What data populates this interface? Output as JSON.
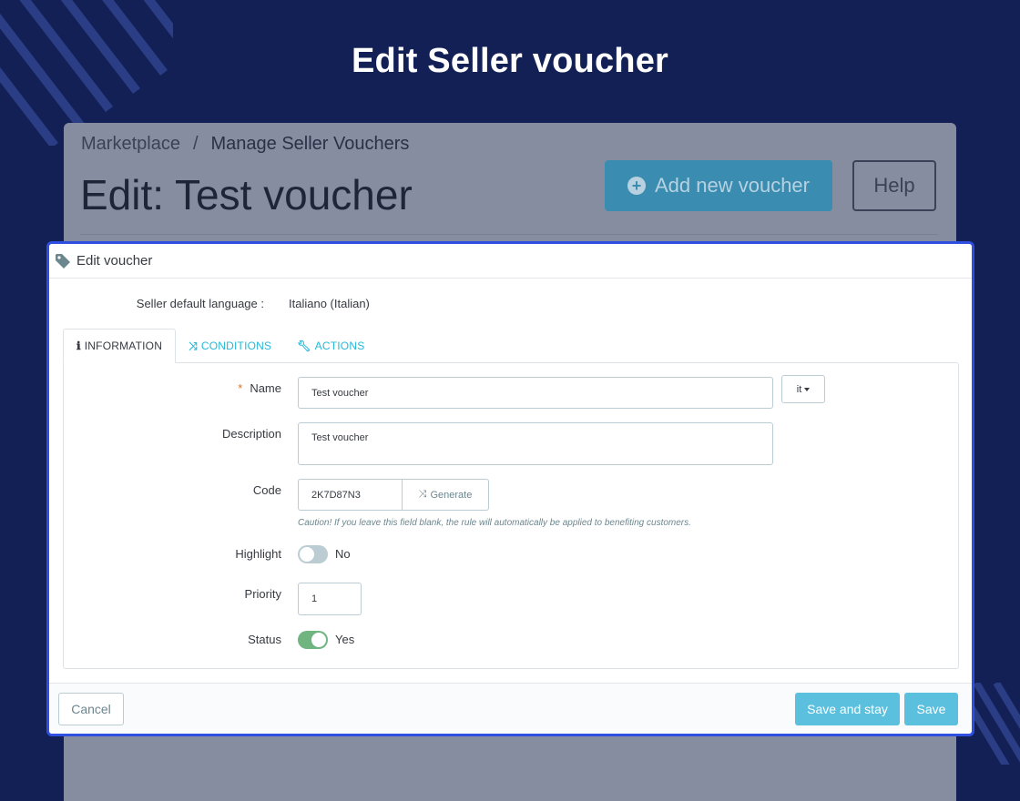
{
  "hero": {
    "title": "Edit Seller voucher"
  },
  "background": {
    "breadcrumb": {
      "root": "Marketplace",
      "separator": "/",
      "current": "Manage Seller Vouchers"
    },
    "page_title": "Edit: Test voucher",
    "add_button": "Add new voucher",
    "help_button": "Help"
  },
  "dialog": {
    "header_title": "Edit voucher",
    "header_icon": "tag-icon",
    "seller_language_label": "Seller default language :",
    "seller_language_value": "Italiano (Italian)",
    "tabs": [
      {
        "label": "INFORMATION",
        "icon": "info-icon",
        "active": true
      },
      {
        "label": "CONDITIONS",
        "icon": "random-icon",
        "active": false
      },
      {
        "label": "ACTIONS",
        "icon": "wrench-icon",
        "active": false
      }
    ],
    "form": {
      "name_required": "*",
      "name_label": "Name",
      "name_value": "Test voucher",
      "lang_selector": "it",
      "description_label": "Description",
      "description_value": "Test voucher",
      "code_label": "Code",
      "code_value": "2K7D87N3",
      "generate_label": "Generate",
      "code_hint": "Caution! If you leave this field blank, the rule will automatically be applied to benefiting customers.",
      "highlight_label": "Highlight",
      "highlight_value": "No",
      "priority_label": "Priority",
      "priority_value": "1",
      "status_label": "Status",
      "status_value": "Yes"
    },
    "footer": {
      "cancel": "Cancel",
      "save_and_stay": "Save and stay",
      "save": "Save"
    }
  },
  "colors": {
    "page_bg": "#132055",
    "accent": "#25b9d7",
    "primary_button": "#5bc0de",
    "switch_on": "#70b580",
    "dialog_border": "#2f4fe0"
  }
}
